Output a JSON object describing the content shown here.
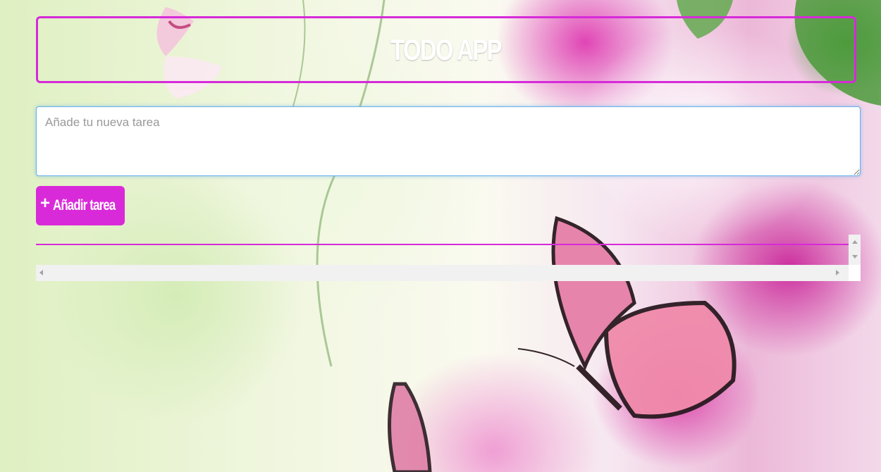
{
  "app": {
    "title": "TODO APP"
  },
  "task_form": {
    "input_value": "",
    "input_placeholder": "Añade tu nueva tarea",
    "add_button_icon": "plus-icon",
    "add_button_label": "Añadir tarea"
  },
  "task_list": {
    "items": []
  },
  "colors": {
    "accent": "#d92ad9",
    "input_focus_border": "#66afe9",
    "header_text": "#ffffff"
  },
  "background": {
    "description_icon": "butterflies-flowers-background"
  }
}
